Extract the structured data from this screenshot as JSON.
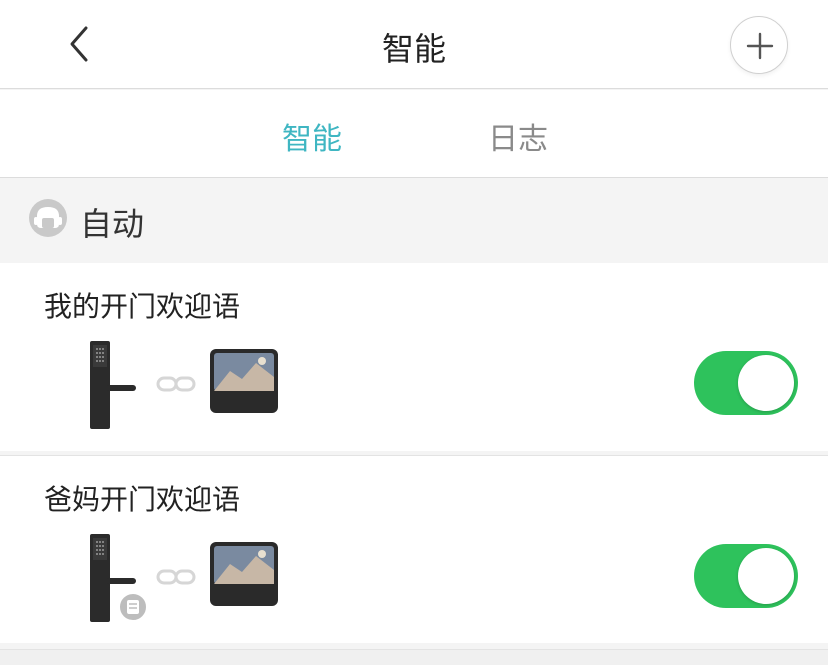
{
  "header": {
    "title": "智能",
    "back_icon": "chevron-left-icon",
    "add_icon": "plus-icon"
  },
  "tabs": [
    {
      "label": "智能",
      "active": true
    },
    {
      "label": "日志",
      "active": false
    }
  ],
  "section": {
    "label": "自动",
    "icon": "robot-head-icon"
  },
  "automations": [
    {
      "title": "我的开门欢迎语",
      "enabled": true,
      "trigger_icon": "smart-lock-icon",
      "action_icon": "smart-display-icon"
    },
    {
      "title": "爸妈开门欢迎语",
      "enabled": true,
      "trigger_icon": "smart-lock-icon",
      "action_icon": "smart-display-icon"
    }
  ],
  "colors": {
    "accent": "#3fb6c2",
    "toggle_on": "#2ec25c",
    "inactive_tab": "#8a8a8a"
  }
}
